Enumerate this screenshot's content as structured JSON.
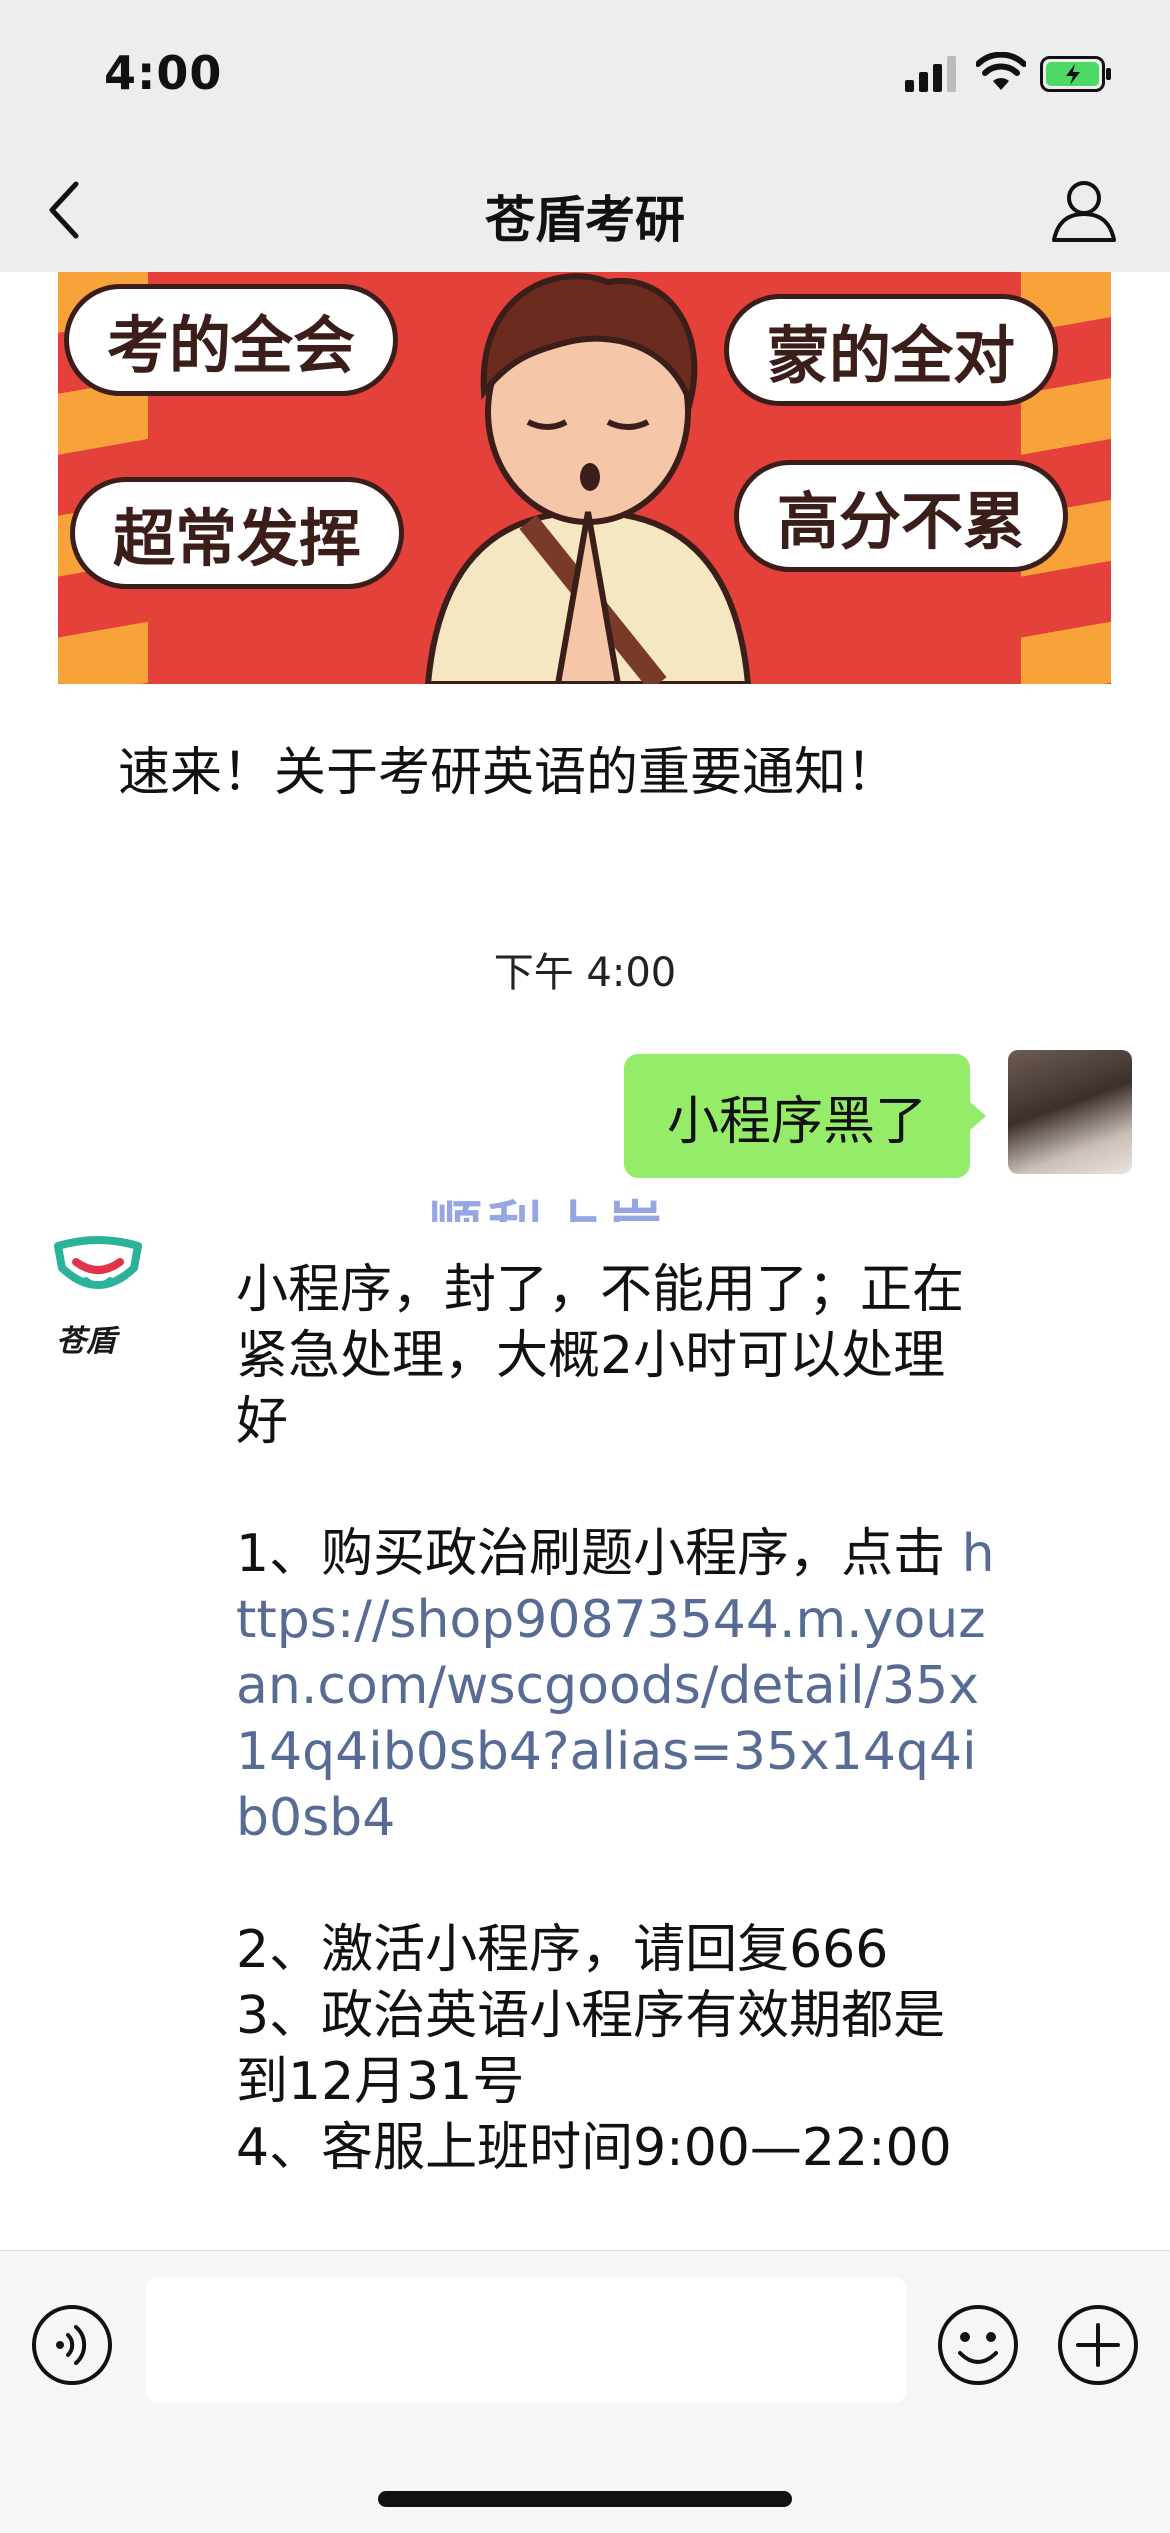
{
  "status_bar": {
    "time": "4:00"
  },
  "nav": {
    "title": "苍盾考研"
  },
  "article": {
    "banner_labels": [
      "考的全会",
      "蒙的全对",
      "超常发挥",
      "高分不累"
    ],
    "title": "速来！关于考研英语的重要通知！"
  },
  "chat": {
    "time_divider": "下午 4:00",
    "outgoing_message": "小程序黑了",
    "watermark": "顺利上岸",
    "brand_avatar_text": "苍盾",
    "incoming": {
      "line1": "小程序，封了，不能用了；正在紧急处理，大概2小时可以处理好",
      "item1_text": "1、购买政治刷题小程序，点击",
      "item1_link": " https://shop90873544.m.youzan.com/wscgoods/detail/35x14q4ib0sb4?alias=35x14q4ib0sb4",
      "item2": "2、激活小程序，请回复666",
      "item3": "3、政治英语小程序有效期都是到12月31号",
      "item4": "4、客服上班时间9:00—22:00"
    }
  },
  "input_bar": {
    "placeholder": ""
  },
  "icons": {
    "back": "chevron-left-icon",
    "profile": "person-icon",
    "voice": "voice-icon",
    "emoji": "emoji-icon",
    "plus": "plus-icon"
  },
  "colors": {
    "outgoing_bubble": "#95ec69",
    "link": "#576b95",
    "bar_background": "#ededed",
    "battery": "#4cd964"
  }
}
